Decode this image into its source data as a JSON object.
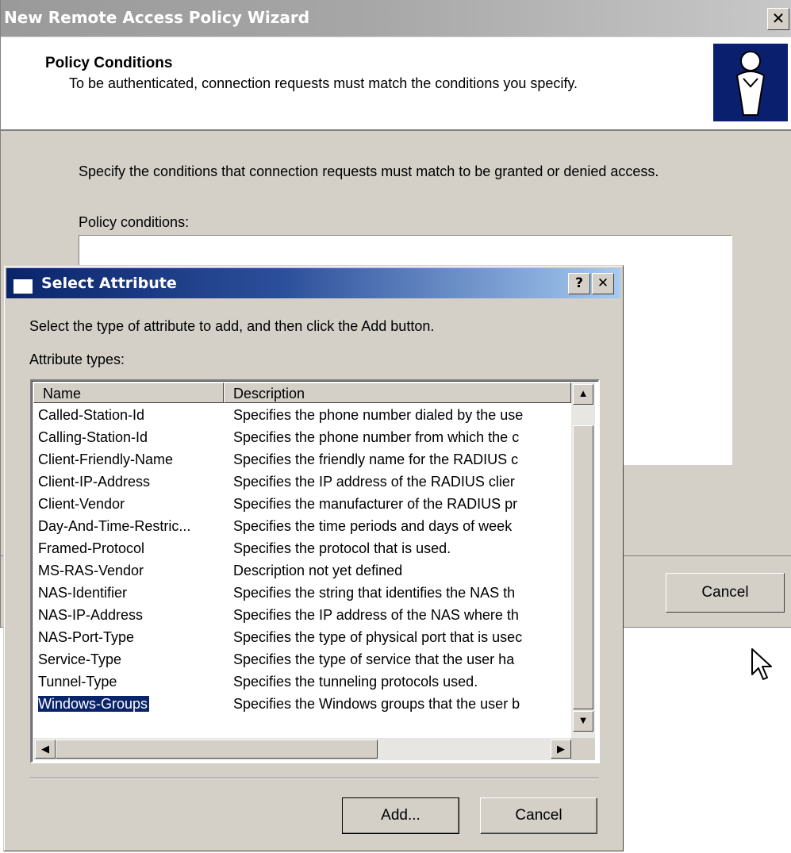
{
  "wizard": {
    "title": "New Remote Access Policy Wizard",
    "close_glyph": "✕",
    "heading": "Policy Conditions",
    "subheading": "To be authenticated, connection requests must match the conditions you specify.",
    "instructions": "Specify the conditions that connection requests must match to be granted or denied access.",
    "conditions_label": "Policy conditions:",
    "cancel_label": "Cancel"
  },
  "dialog": {
    "title": "Select Attribute",
    "help_glyph": "?",
    "close_glyph": "✕",
    "instruction": "Select the type of attribute to add, and then click the Add button.",
    "attribute_types_label": "Attribute types:",
    "columns": {
      "name": "Name",
      "description": "Description"
    },
    "rows": [
      {
        "name": "Called-Station-Id",
        "description": "Specifies the phone number dialed by the use"
      },
      {
        "name": "Calling-Station-Id",
        "description": "Specifies the phone number from which the c"
      },
      {
        "name": "Client-Friendly-Name",
        "description": "Specifies the friendly name for the RADIUS c"
      },
      {
        "name": "Client-IP-Address",
        "description": "Specifies the IP address of the RADIUS clier"
      },
      {
        "name": "Client-Vendor",
        "description": "Specifies the manufacturer of the RADIUS pr"
      },
      {
        "name": "Day-And-Time-Restric...",
        "description": "Specifies the time periods and days of week"
      },
      {
        "name": "Framed-Protocol",
        "description": "Specifies the protocol that is used."
      },
      {
        "name": "MS-RAS-Vendor",
        "description": "Description not yet defined"
      },
      {
        "name": "NAS-Identifier",
        "description": "Specifies the string that identifies the NAS th"
      },
      {
        "name": "NAS-IP-Address",
        "description": "Specifies the IP address of the NAS where th"
      },
      {
        "name": "NAS-Port-Type",
        "description": "Specifies the type of physical port that is usec"
      },
      {
        "name": "Service-Type",
        "description": "Specifies the type of service that the user ha"
      },
      {
        "name": "Tunnel-Type",
        "description": "Specifies the tunneling protocols used."
      },
      {
        "name": "Windows-Groups",
        "description": "Specifies the Windows groups that the user b"
      }
    ],
    "selected_row": "Windows-Groups",
    "add_label": "Add...",
    "cancel_label": "Cancel"
  },
  "colors": {
    "dialog_titlebar": "#0a246a",
    "window_face": "#d4d0c8",
    "selection": "#0a246a"
  }
}
